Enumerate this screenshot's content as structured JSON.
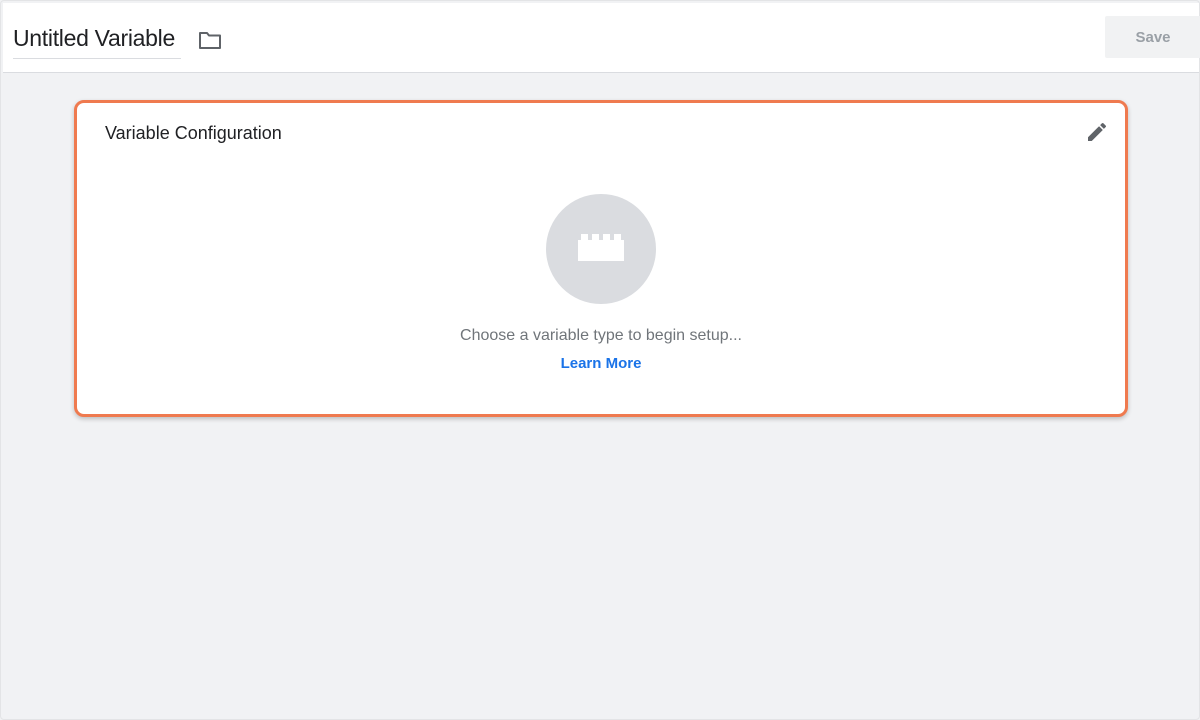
{
  "header": {
    "title": "Untitled Variable",
    "folder_icon": "folder-icon",
    "save_label": "Save"
  },
  "card": {
    "title": "Variable Configuration",
    "edit_icon": "pencil-icon",
    "placeholder_icon": "block-icon",
    "empty_text": "Choose a variable type to begin setup...",
    "learn_more": "Learn More"
  },
  "colors": {
    "accent_border": "#ef7a4f",
    "link": "#1a73e8",
    "background": "#f1f2f4"
  }
}
